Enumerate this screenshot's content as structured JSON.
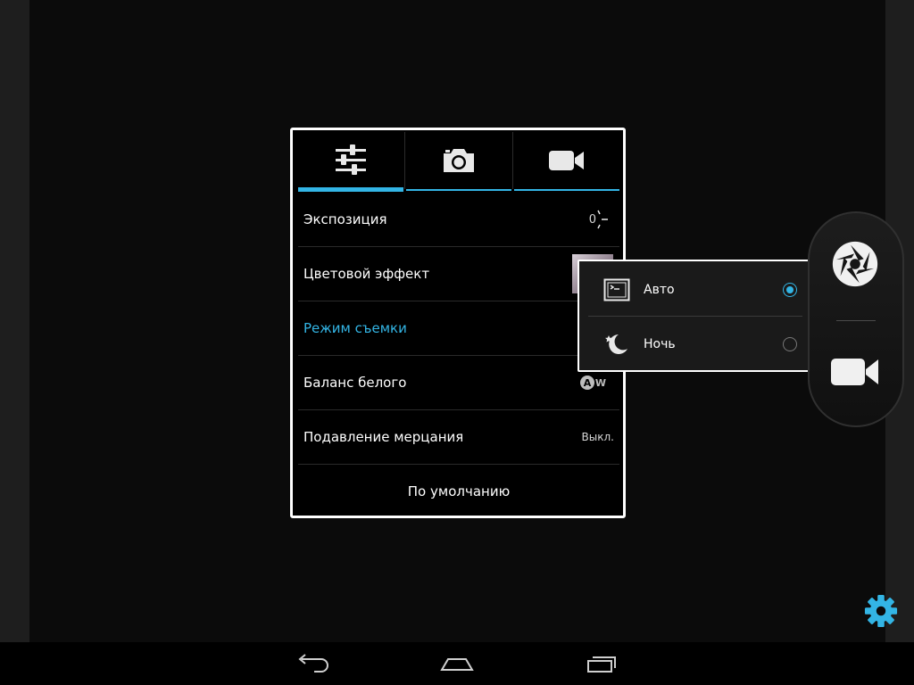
{
  "settings": {
    "tabs": [
      {
        "icon": "sliders-icon",
        "active": true
      },
      {
        "icon": "camera-icon",
        "active": false
      },
      {
        "icon": "video-camera-icon",
        "active": false
      }
    ],
    "rows": [
      {
        "label": "Экспозиция",
        "value": "0"
      },
      {
        "label": "Цветовой эффект"
      },
      {
        "label": "Режим съемки"
      },
      {
        "label": "Баланс белого",
        "value_icon": "auto-white-balance-icon"
      },
      {
        "label": "Подавление мерцания",
        "value": "Выкл."
      }
    ],
    "reset_label": "По умолчанию"
  },
  "scene_popup": {
    "options": [
      {
        "label": "Авто",
        "icon": "auto-scene-icon",
        "selected": true
      },
      {
        "label": "Ночь",
        "icon": "night-scene-icon",
        "selected": false
      }
    ]
  },
  "colors": {
    "accent": "#33b5e5",
    "panel_border": "#ffffff",
    "background": "#0b0b0b"
  }
}
